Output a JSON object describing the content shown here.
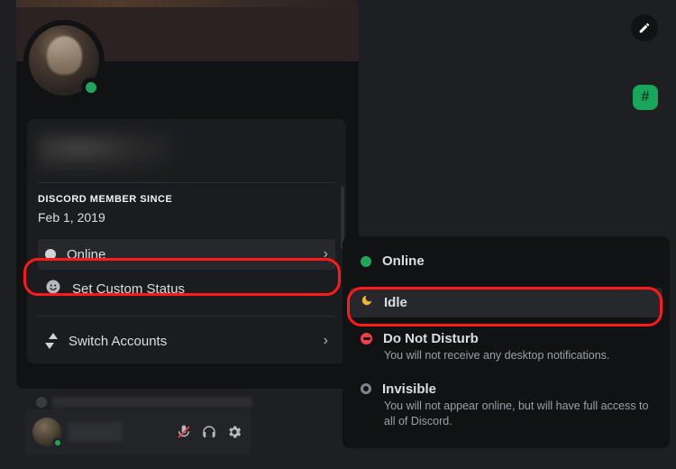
{
  "profile": {
    "member_since_label": "DISCORD MEMBER SINCE",
    "member_since_value": "Feb 1, 2019"
  },
  "menu": {
    "status_label": "Online",
    "custom_status_label": "Set Custom Status",
    "switch_accounts_label": "Switch Accounts"
  },
  "hash_badge": "#",
  "status_popout": {
    "online": {
      "title": "Online"
    },
    "idle": {
      "title": "Idle"
    },
    "dnd": {
      "title": "Do Not Disturb",
      "subtitle": "You will not receive any desktop notifications."
    },
    "invisible": {
      "title": "Invisible",
      "subtitle": "You will not appear online, but will have full access to all of Discord."
    }
  },
  "colors": {
    "online": "#23a559",
    "idle": "#f0b232",
    "dnd": "#f23f43",
    "offline": "#80848e",
    "highlight": "#ff1a1a"
  }
}
